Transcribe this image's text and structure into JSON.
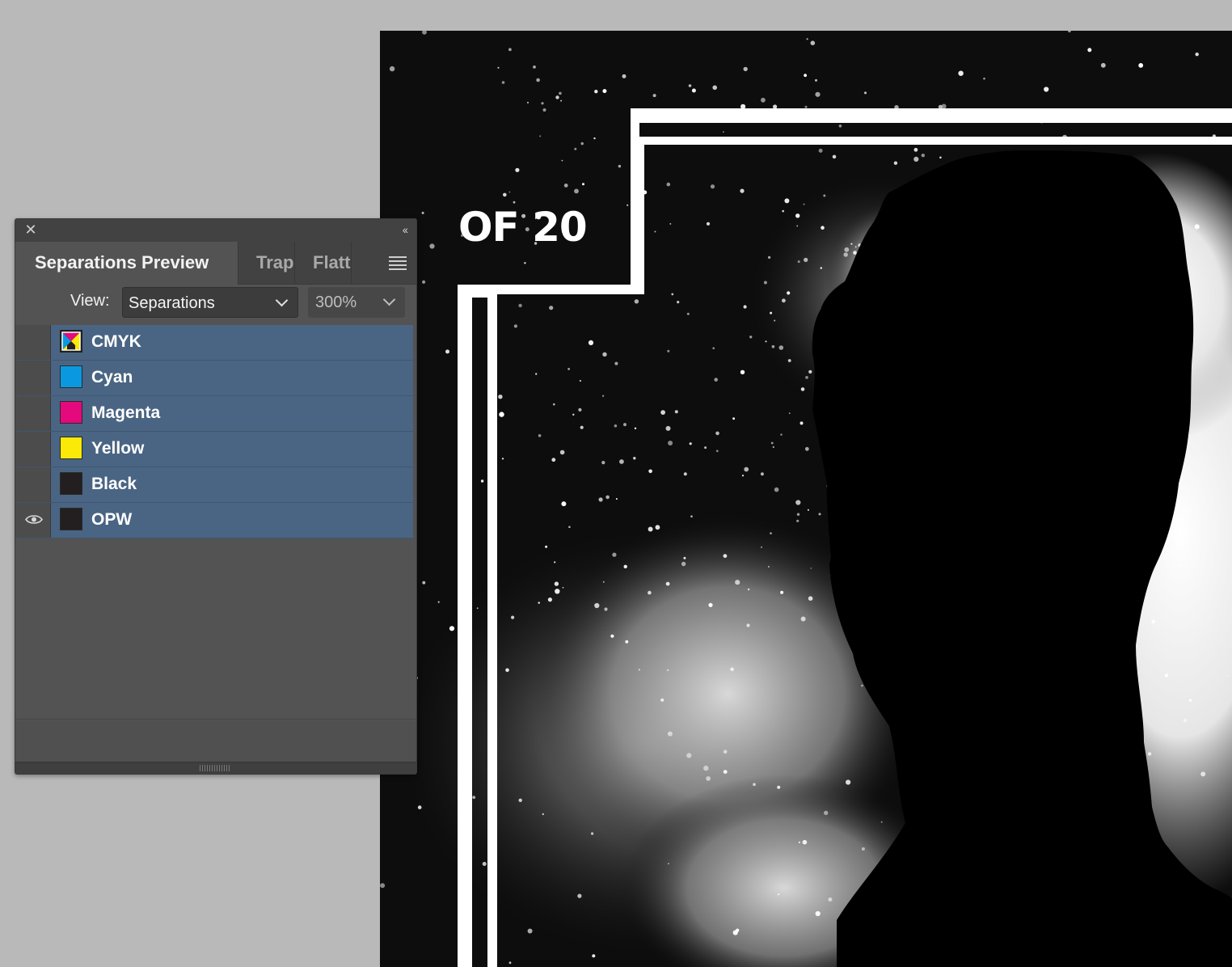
{
  "document": {
    "overlay_text": "OF 20"
  },
  "panel": {
    "tabs": [
      {
        "label": "Separations Preview",
        "active": true
      },
      {
        "label": "Trap",
        "active": false
      },
      {
        "label": "Flattener Preview",
        "active": false
      }
    ],
    "view_label": "View:",
    "view_value": "Separations",
    "zoom_value": "300%",
    "plates": [
      {
        "name": "CMYK",
        "swatch": "cmyk",
        "visible": false
      },
      {
        "name": "Cyan",
        "swatch": "#0a99e0",
        "visible": false
      },
      {
        "name": "Magenta",
        "swatch": "#e4097c",
        "visible": false
      },
      {
        "name": "Yellow",
        "swatch": "#fbea08",
        "visible": false
      },
      {
        "name": "Black",
        "swatch": "#231f20",
        "visible": false
      },
      {
        "name": "OPW",
        "swatch": "#231f20",
        "visible": true
      }
    ],
    "icons": [
      "close-icon",
      "collapse-icon",
      "panel-menu-icon",
      "eye-icon",
      "chevron-down-icon"
    ],
    "selection_color": "#4a6583"
  }
}
